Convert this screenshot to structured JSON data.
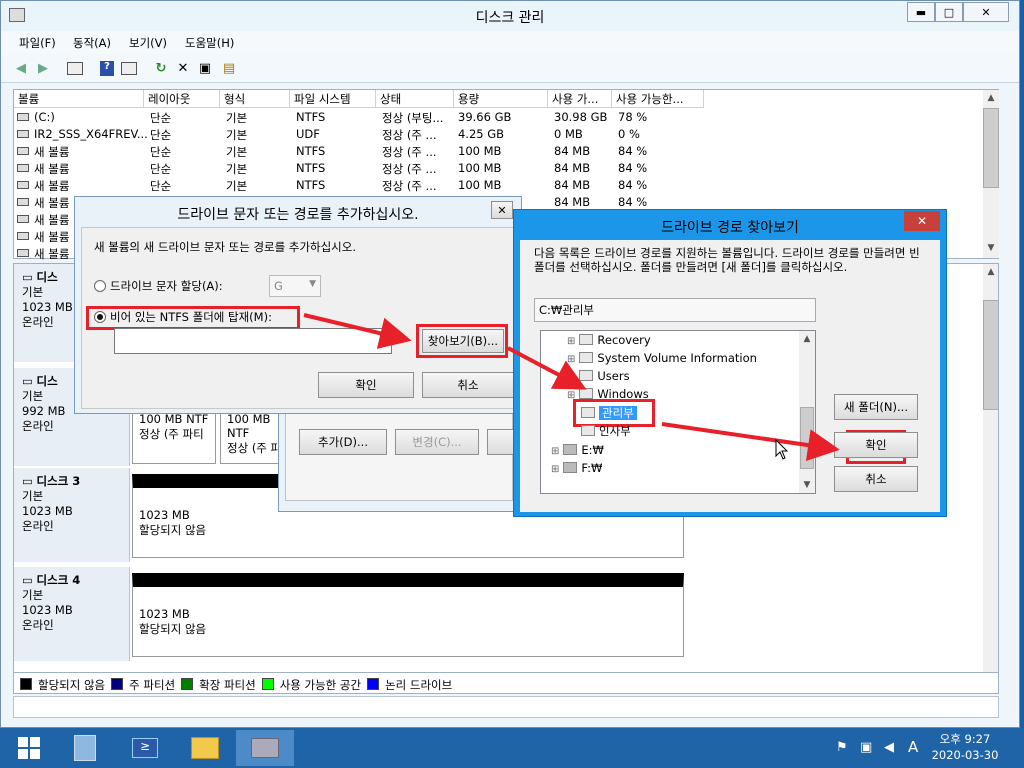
{
  "window": {
    "title": "디스크 관리",
    "controls": [
      "▬",
      "□",
      "✕"
    ]
  },
  "menu": [
    "파일(F)",
    "동작(A)",
    "보기(V)",
    "도움말(H)"
  ],
  "table": {
    "headers": [
      "볼륨",
      "레이아웃",
      "형식",
      "파일 시스템",
      "상태",
      "용량",
      "사용 가...",
      "사용 가능한..."
    ],
    "rows": [
      [
        "(C:)",
        "단순",
        "기본",
        "NTFS",
        "정상 (부팅...",
        "39.66 GB",
        "30.98 GB",
        "78 %"
      ],
      [
        "IR2_SSS_X64FREV...",
        "단순",
        "기본",
        "UDF",
        "정상 (주 ...",
        "4.25 GB",
        "0 MB",
        "0 %"
      ],
      [
        "새 볼륨",
        "단순",
        "기본",
        "NTFS",
        "정상 (주 ...",
        "100 MB",
        "84 MB",
        "84 %"
      ],
      [
        "새 볼륨",
        "단순",
        "기본",
        "NTFS",
        "정상 (주 ...",
        "100 MB",
        "84 MB",
        "84 %"
      ],
      [
        "새 볼륨",
        "단순",
        "기본",
        "NTFS",
        "정상 (주 ...",
        "100 MB",
        "84 MB",
        "84 %"
      ],
      [
        "새 볼륨",
        "",
        "",
        "",
        "",
        "",
        "84 MB",
        "84 %"
      ],
      [
        "새 볼륨",
        "",
        "",
        "",
        "",
        "",
        "",
        ""
      ],
      [
        "새 볼륨",
        "",
        "",
        "",
        "",
        "",
        "",
        ""
      ],
      [
        "새 볼륨",
        "",
        "",
        "",
        "",
        "",
        "",
        ""
      ]
    ]
  },
  "disks": [
    {
      "name": "디스",
      "type": "기본",
      "size": "1023 MB",
      "status": "온라인"
    },
    {
      "name": "디스",
      "type": "기본",
      "size": "992 MB",
      "status": "온라인",
      "part1_size": "100 MB NTF",
      "part1_status": "정상 (주 파티",
      "part2_size": "100 MB NTF",
      "part2_status": "정상 (주 파"
    },
    {
      "name": "디스크 3",
      "type": "기본",
      "size": "1023 MB",
      "status": "온라인",
      "part_size": "1023 MB",
      "part_status": "할당되지 않음"
    },
    {
      "name": "디스크 4",
      "type": "기본",
      "size": "1023 MB",
      "status": "온라인",
      "part_size": "1023 MB",
      "part_status": "할당되지 않음"
    }
  ],
  "legend": [
    {
      "label": "할당되지 않음",
      "color": "#000000"
    },
    {
      "label": "주 파티션",
      "color": "#00007f"
    },
    {
      "label": "확장 파티션",
      "color": "#007f00"
    },
    {
      "label": "사용 가능한 공간",
      "color": "#00ff00"
    },
    {
      "label": "논리 드라이브",
      "color": "#0000ff"
    }
  ],
  "dialog_add": {
    "title": "드라이브 문자 또는 경로를 추가하십시오.",
    "desc": "새 볼륨의 새 드라이브 문자 또는 경로를 추가하십시오.",
    "option1": "드라이브 문자 할당(A):",
    "drive_letter": "G",
    "option2": "비어 있는 NTFS 폴더에 탑재(M):",
    "browse": "찾아보기(B)...",
    "ok": "확인",
    "cancel": "취소"
  },
  "dialog_back": {
    "add": "추가(D)...",
    "change": "변경(C)..."
  },
  "dialog_browse": {
    "title": "드라이브 경로 찾아보기",
    "desc": "다음 목록은 드라이브 경로를 지원하는 볼륨입니다. 드라이브 경로를 만들려면 빈 폴더를 선택하십시오. 폴더를 만들려면 [새 폴더]를 클릭하십시오.",
    "path": "C:₩관리부",
    "tree": [
      "Recovery",
      "System Volume Information",
      "Users",
      "Windows",
      "관리부",
      "인사부",
      "E:₩",
      "F:₩"
    ],
    "new_folder": "새 폴더(N)...",
    "ok": "확인",
    "cancel": "취소"
  },
  "taskbar": {
    "time": "오후 9:27",
    "date": "2020-03-30",
    "ime": "A"
  },
  "colors": {
    "highlight": "#e8202a",
    "selection": "#3399ff",
    "taskbar": "#1f64a6"
  }
}
